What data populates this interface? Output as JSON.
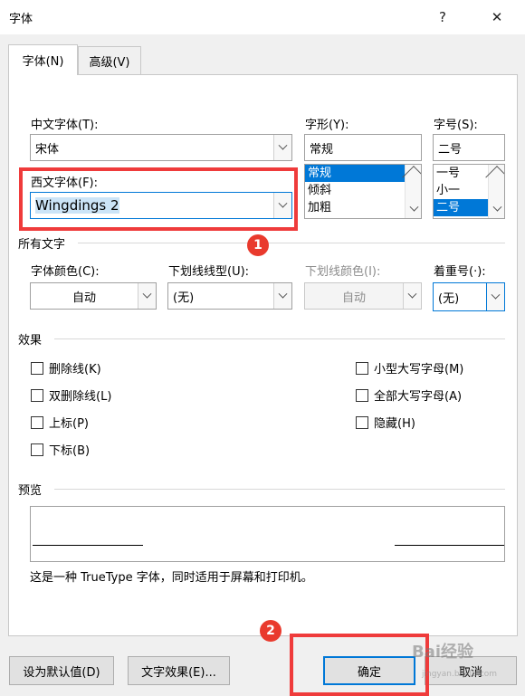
{
  "window": {
    "title": "字体",
    "help_glyph": "?",
    "close_glyph": "✕"
  },
  "tabs": [
    {
      "label": "字体(N)",
      "active": true
    },
    {
      "label": "高级(V)",
      "active": false
    }
  ],
  "font": {
    "chinese_label": "中文字体(T):",
    "chinese_value": "宋体",
    "western_label": "西文字体(F):",
    "western_value": "Wingdings 2",
    "style_label": "字形(Y):",
    "style_value": "常规",
    "style_options": [
      "常规",
      "倾斜",
      "加粗"
    ],
    "size_label": "字号(S):",
    "size_value": "二号",
    "size_options": [
      "一号",
      "小一",
      "二号"
    ]
  },
  "all_text": {
    "section_label": "所有文字",
    "color_label": "字体颜色(C):",
    "color_value": "自动",
    "underline_label": "下划线线型(U):",
    "underline_value": "(无)",
    "underline_color_label": "下划线颜色(I):",
    "underline_color_value": "自动",
    "emphasis_label": "着重号(·):",
    "emphasis_value": "(无)"
  },
  "effects": {
    "section_label": "效果",
    "left": [
      "删除线(K)",
      "双删除线(L)",
      "上标(P)",
      "下标(B)"
    ],
    "right": [
      "小型大写字母(M)",
      "全部大写字母(A)",
      "隐藏(H)"
    ]
  },
  "preview": {
    "section_label": "预览",
    "note": "这是一种 TrueType 字体，同时适用于屏幕和打印机。"
  },
  "buttons": {
    "set_default": "设为默认值(D)",
    "text_effects": "文字效果(E)...",
    "ok": "确定",
    "cancel": "取消"
  },
  "annotations": {
    "badge1": "1",
    "badge2": "2",
    "highlight_color": "#ef3b3b"
  },
  "watermark": {
    "brand": "Bai经验",
    "url": "jingyan.baidu.com"
  },
  "colors": {
    "selection": "#0078d7",
    "accent_focus": "#0078d7"
  }
}
